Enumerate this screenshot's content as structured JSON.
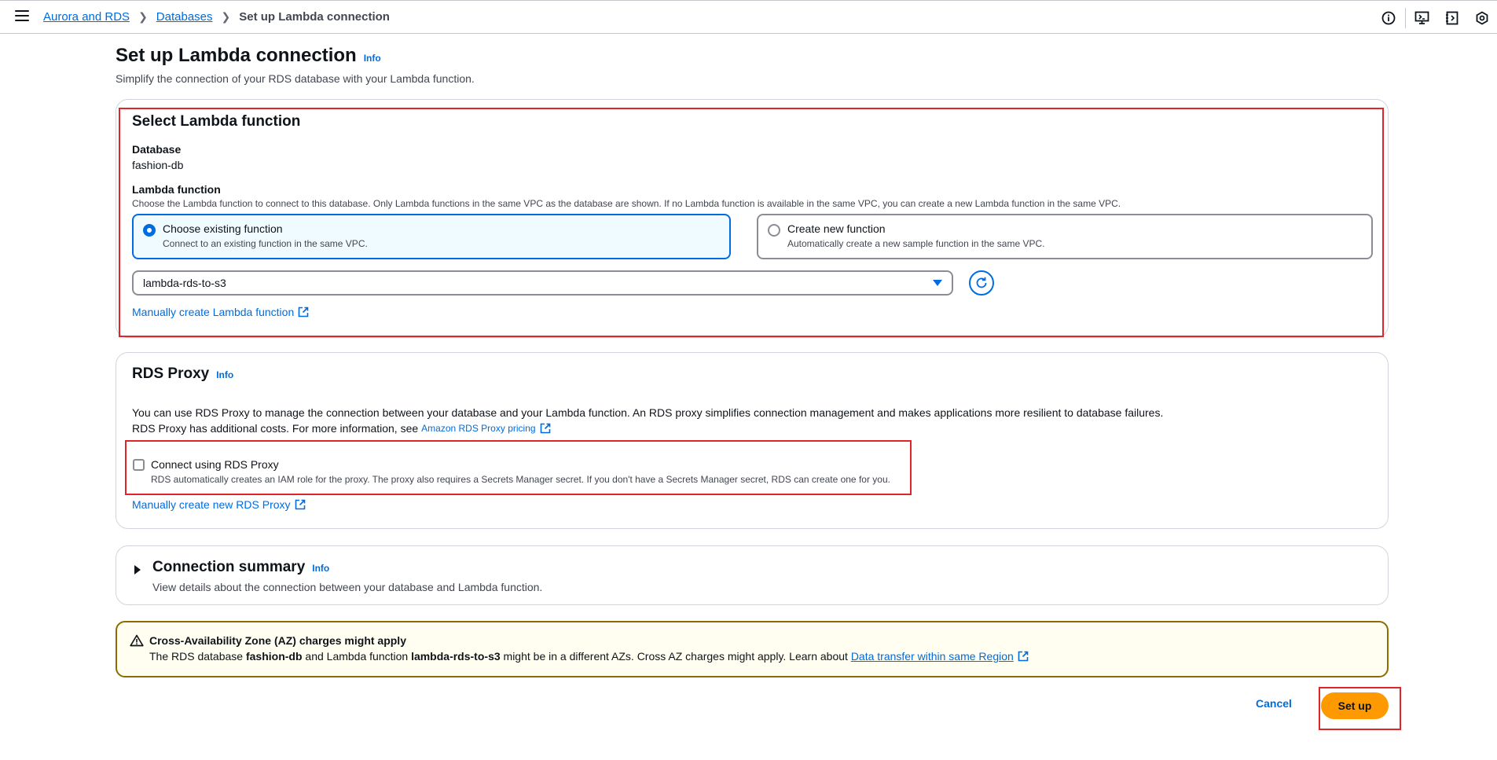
{
  "breadcrumbs": {
    "item1": "Aurora and RDS",
    "item2": "Databases",
    "current": "Set up Lambda connection"
  },
  "page": {
    "title": "Set up Lambda connection",
    "info": "Info",
    "description": "Simplify the connection of your RDS database with your Lambda function."
  },
  "lambda_section": {
    "title": "Select Lambda function",
    "database_label": "Database",
    "database_value": "fashion-db",
    "function_label": "Lambda function",
    "function_desc": "Choose the Lambda function to connect to this database. Only Lambda functions in the same VPC as the database are shown. If no Lambda function is available in the same VPC, you can create a new Lambda function in the same VPC.",
    "option_existing_title": "Choose existing function",
    "option_existing_desc": "Connect to an existing function in the same VPC.",
    "option_new_title": "Create new function",
    "option_new_desc": "Automatically create a new sample function in the same VPC.",
    "selected_function": "lambda-rds-to-s3",
    "manual_link": "Manually create Lambda function"
  },
  "proxy_section": {
    "title": "RDS Proxy",
    "info": "Info",
    "desc_line1": "You can use RDS Proxy to manage the connection between your database and your Lambda function. An RDS proxy simplifies connection management and makes applications more resilient to database failures.",
    "desc_line2": "RDS Proxy has additional costs. For more information, see",
    "pricing_link": "Amazon RDS Proxy pricing",
    "checkbox_label": "Connect using RDS Proxy",
    "checkbox_desc": "RDS automatically creates an IAM role for the proxy. The proxy also requires a Secrets Manager secret. If you don't have a Secrets Manager secret, RDS can create one for you.",
    "manual_link": "Manually create new RDS Proxy"
  },
  "summary_section": {
    "title": "Connection summary",
    "info": "Info",
    "desc": "View details about the connection between your database and Lambda function."
  },
  "warning": {
    "title": "Cross-Availability Zone (AZ) charges might apply",
    "text1": "The RDS database",
    "db": "fashion-db",
    "text2": "and Lambda function",
    "fn": "lambda-rds-to-s3",
    "text3": "might be in a different AZs. Cross AZ charges might apply. Learn about",
    "link": "Data transfer within same Region"
  },
  "actions": {
    "cancel": "Cancel",
    "submit": "Set up"
  },
  "colors": {
    "link": "#006ce0",
    "primary": "#ff9900",
    "highlight": "#e0242b",
    "warning_border": "#8c6b00"
  }
}
